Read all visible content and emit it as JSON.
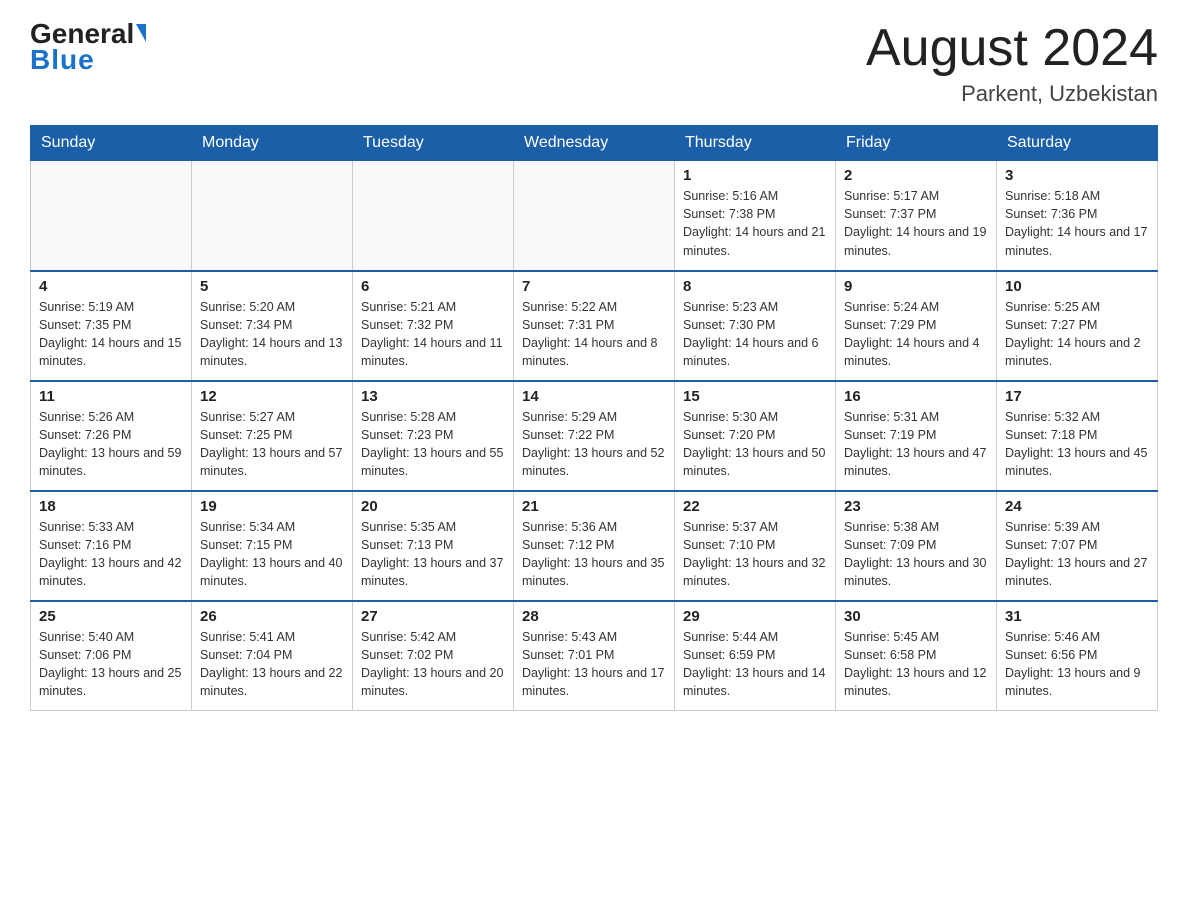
{
  "header": {
    "logo_general": "General",
    "logo_blue": "Blue",
    "month_title": "August 2024",
    "location": "Parkent, Uzbekistan"
  },
  "days_of_week": [
    "Sunday",
    "Monday",
    "Tuesday",
    "Wednesday",
    "Thursday",
    "Friday",
    "Saturday"
  ],
  "weeks": [
    [
      {
        "day": "",
        "info": ""
      },
      {
        "day": "",
        "info": ""
      },
      {
        "day": "",
        "info": ""
      },
      {
        "day": "",
        "info": ""
      },
      {
        "day": "1",
        "info": "Sunrise: 5:16 AM\nSunset: 7:38 PM\nDaylight: 14 hours and 21 minutes."
      },
      {
        "day": "2",
        "info": "Sunrise: 5:17 AM\nSunset: 7:37 PM\nDaylight: 14 hours and 19 minutes."
      },
      {
        "day": "3",
        "info": "Sunrise: 5:18 AM\nSunset: 7:36 PM\nDaylight: 14 hours and 17 minutes."
      }
    ],
    [
      {
        "day": "4",
        "info": "Sunrise: 5:19 AM\nSunset: 7:35 PM\nDaylight: 14 hours and 15 minutes."
      },
      {
        "day": "5",
        "info": "Sunrise: 5:20 AM\nSunset: 7:34 PM\nDaylight: 14 hours and 13 minutes."
      },
      {
        "day": "6",
        "info": "Sunrise: 5:21 AM\nSunset: 7:32 PM\nDaylight: 14 hours and 11 minutes."
      },
      {
        "day": "7",
        "info": "Sunrise: 5:22 AM\nSunset: 7:31 PM\nDaylight: 14 hours and 8 minutes."
      },
      {
        "day": "8",
        "info": "Sunrise: 5:23 AM\nSunset: 7:30 PM\nDaylight: 14 hours and 6 minutes."
      },
      {
        "day": "9",
        "info": "Sunrise: 5:24 AM\nSunset: 7:29 PM\nDaylight: 14 hours and 4 minutes."
      },
      {
        "day": "10",
        "info": "Sunrise: 5:25 AM\nSunset: 7:27 PM\nDaylight: 14 hours and 2 minutes."
      }
    ],
    [
      {
        "day": "11",
        "info": "Sunrise: 5:26 AM\nSunset: 7:26 PM\nDaylight: 13 hours and 59 minutes."
      },
      {
        "day": "12",
        "info": "Sunrise: 5:27 AM\nSunset: 7:25 PM\nDaylight: 13 hours and 57 minutes."
      },
      {
        "day": "13",
        "info": "Sunrise: 5:28 AM\nSunset: 7:23 PM\nDaylight: 13 hours and 55 minutes."
      },
      {
        "day": "14",
        "info": "Sunrise: 5:29 AM\nSunset: 7:22 PM\nDaylight: 13 hours and 52 minutes."
      },
      {
        "day": "15",
        "info": "Sunrise: 5:30 AM\nSunset: 7:20 PM\nDaylight: 13 hours and 50 minutes."
      },
      {
        "day": "16",
        "info": "Sunrise: 5:31 AM\nSunset: 7:19 PM\nDaylight: 13 hours and 47 minutes."
      },
      {
        "day": "17",
        "info": "Sunrise: 5:32 AM\nSunset: 7:18 PM\nDaylight: 13 hours and 45 minutes."
      }
    ],
    [
      {
        "day": "18",
        "info": "Sunrise: 5:33 AM\nSunset: 7:16 PM\nDaylight: 13 hours and 42 minutes."
      },
      {
        "day": "19",
        "info": "Sunrise: 5:34 AM\nSunset: 7:15 PM\nDaylight: 13 hours and 40 minutes."
      },
      {
        "day": "20",
        "info": "Sunrise: 5:35 AM\nSunset: 7:13 PM\nDaylight: 13 hours and 37 minutes."
      },
      {
        "day": "21",
        "info": "Sunrise: 5:36 AM\nSunset: 7:12 PM\nDaylight: 13 hours and 35 minutes."
      },
      {
        "day": "22",
        "info": "Sunrise: 5:37 AM\nSunset: 7:10 PM\nDaylight: 13 hours and 32 minutes."
      },
      {
        "day": "23",
        "info": "Sunrise: 5:38 AM\nSunset: 7:09 PM\nDaylight: 13 hours and 30 minutes."
      },
      {
        "day": "24",
        "info": "Sunrise: 5:39 AM\nSunset: 7:07 PM\nDaylight: 13 hours and 27 minutes."
      }
    ],
    [
      {
        "day": "25",
        "info": "Sunrise: 5:40 AM\nSunset: 7:06 PM\nDaylight: 13 hours and 25 minutes."
      },
      {
        "day": "26",
        "info": "Sunrise: 5:41 AM\nSunset: 7:04 PM\nDaylight: 13 hours and 22 minutes."
      },
      {
        "day": "27",
        "info": "Sunrise: 5:42 AM\nSunset: 7:02 PM\nDaylight: 13 hours and 20 minutes."
      },
      {
        "day": "28",
        "info": "Sunrise: 5:43 AM\nSunset: 7:01 PM\nDaylight: 13 hours and 17 minutes."
      },
      {
        "day": "29",
        "info": "Sunrise: 5:44 AM\nSunset: 6:59 PM\nDaylight: 13 hours and 14 minutes."
      },
      {
        "day": "30",
        "info": "Sunrise: 5:45 AM\nSunset: 6:58 PM\nDaylight: 13 hours and 12 minutes."
      },
      {
        "day": "31",
        "info": "Sunrise: 5:46 AM\nSunset: 6:56 PM\nDaylight: 13 hours and 9 minutes."
      }
    ]
  ]
}
